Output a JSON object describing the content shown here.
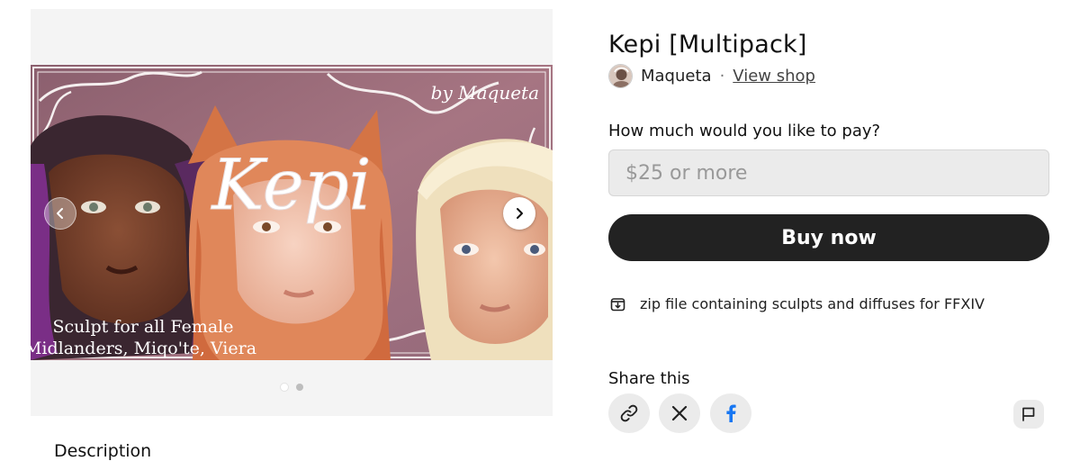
{
  "product": {
    "title": "Kepi [Multipack]",
    "seller_name": "Maqueta",
    "separator": "·",
    "view_shop_label": "View shop"
  },
  "gallery": {
    "slide_title": "Kepi",
    "slide_credit": "by Maqueta",
    "slide_caption_line1": "Sculpt for all Female",
    "slide_caption_line2": "Midlanders, Miqo'te, Viera",
    "current_slide": 1,
    "total_slides": 2
  },
  "purchase": {
    "question": "How much would you like to pay?",
    "price_placeholder": "$25 or more",
    "buy_label": "Buy now",
    "file_info": "zip file containing sculpts and diffuses for FFXIV"
  },
  "share": {
    "heading": "Share this"
  },
  "description": {
    "heading": "Description"
  },
  "icons": {
    "prev": "chevron-left-icon",
    "next": "chevron-right-icon",
    "file": "file-download-icon",
    "link": "link-icon",
    "x": "x-logo-icon",
    "facebook": "facebook-icon",
    "report": "flag-icon"
  },
  "colors": {
    "buy_button": "#222222",
    "facebook_blue": "#1877F2",
    "slide_background": "#9a6a78"
  }
}
